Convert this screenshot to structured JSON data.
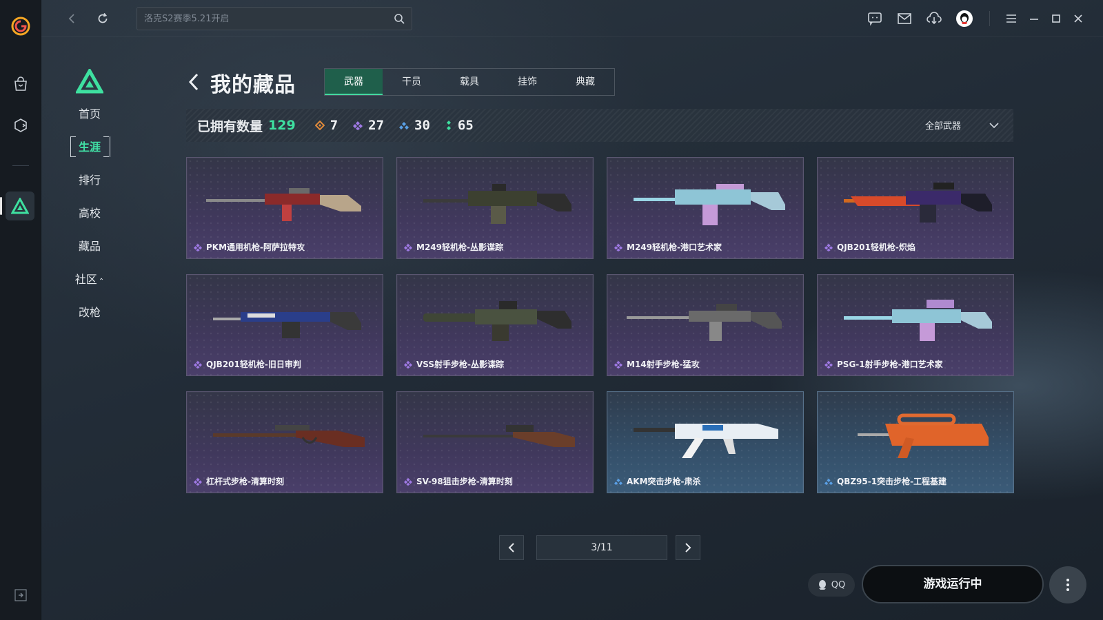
{
  "topbar": {
    "search_placeholder": "洛克S2赛季5.21开启"
  },
  "secondary_nav": {
    "items": [
      {
        "label": "首页"
      },
      {
        "label": "生涯"
      },
      {
        "label": "排行"
      },
      {
        "label": "高校"
      },
      {
        "label": "藏品"
      },
      {
        "label": "社区",
        "caret": "⌃"
      },
      {
        "label": "改枪"
      }
    ]
  },
  "collection": {
    "title": "我的藏品",
    "tabs": [
      "武器",
      "干员",
      "载具",
      "挂饰",
      "典藏"
    ],
    "owned_label": "已拥有数量",
    "owned_total": "129",
    "rarity_counts": [
      {
        "value": "7",
        "color": "#e08a3a"
      },
      {
        "value": "27",
        "color": "#a07ae6"
      },
      {
        "value": "30",
        "color": "#5aa0e6"
      },
      {
        "value": "65",
        "color": "#3ee0a0"
      }
    ],
    "filter_label": "全部武器",
    "items": [
      {
        "name": "PKM通用机枪-阿萨拉特攻",
        "rarity": "purple"
      },
      {
        "name": "M249轻机枪-丛影谍踪",
        "rarity": "purple"
      },
      {
        "name": "M249轻机枪-港口艺术家",
        "rarity": "purple"
      },
      {
        "name": "QJB201轻机枪-炽焰",
        "rarity": "purple"
      },
      {
        "name": "QJB201轻机枪-旧日审判",
        "rarity": "purple"
      },
      {
        "name": "VSS射手步枪-丛影谍踪",
        "rarity": "purple"
      },
      {
        "name": "M14射手步枪-猛攻",
        "rarity": "purple"
      },
      {
        "name": "PSG-1射手步枪-港口艺术家",
        "rarity": "purple"
      },
      {
        "name": "杠杆式步枪-清算时刻",
        "rarity": "purple"
      },
      {
        "name": "SV-98狙击步枪-清算时刻",
        "rarity": "purple"
      },
      {
        "name": "AKM突击步枪-肃杀",
        "rarity": "blue"
      },
      {
        "name": "QBZ95-1突击步枪-工程基建",
        "rarity": "blue"
      }
    ]
  },
  "pagination": {
    "page": "3/11"
  },
  "footer": {
    "qq_label": "QQ",
    "launch_label": "游戏运行中"
  },
  "colors": {
    "accent_green": "#3ee0a0",
    "purple_gem": "#a07ae6",
    "blue_gem": "#5aa0e6"
  }
}
